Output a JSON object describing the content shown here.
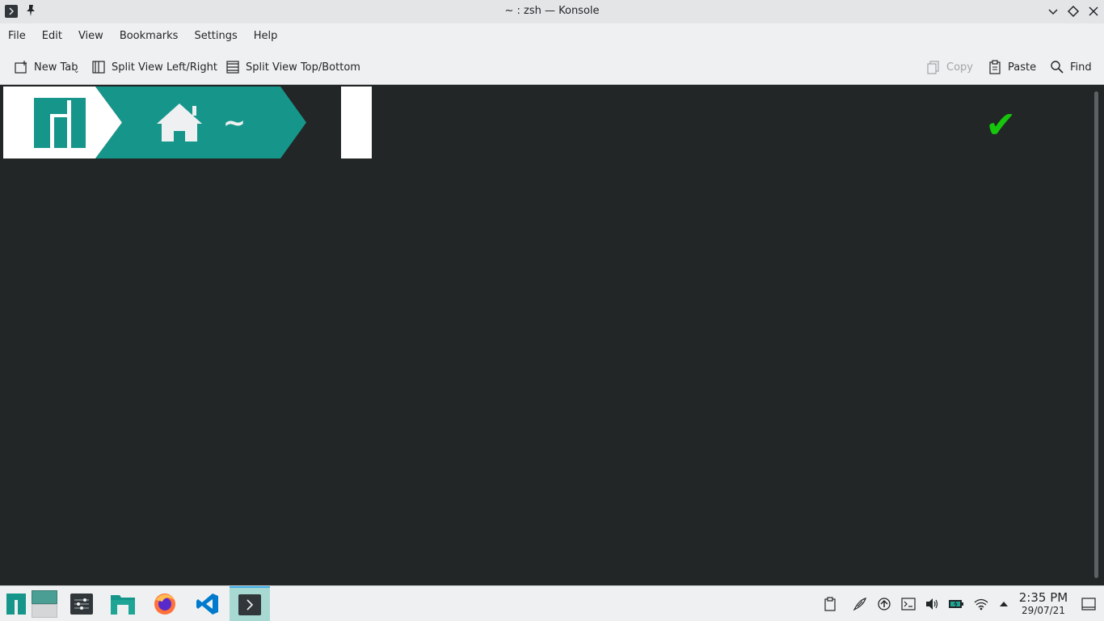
{
  "window": {
    "title": "~ : zsh — Konsole"
  },
  "menu": [
    "File",
    "Edit",
    "View",
    "Bookmarks",
    "Settings",
    "Help"
  ],
  "toolbar": {
    "new_tab": "New Tab",
    "split_lr": "Split View Left/Right",
    "split_tb": "Split View Top/Bottom",
    "copy": "Copy",
    "paste": "Paste",
    "find": "Find"
  },
  "terminal": {
    "prompt_dir": "~",
    "status_symbol": "✔"
  },
  "taskbar": {
    "tasks": [
      "manjaro-menu-icon",
      "desktop-pager",
      "settings-app-icon",
      "file-manager-icon",
      "firefox-icon",
      "vscode-icon",
      "konsole-icon"
    ],
    "clock": {
      "time": "2:35 PM",
      "date": "29/07/21"
    }
  },
  "colors": {
    "accent_teal": "#16968a",
    "terminal_bg": "#232627",
    "check_green": "#16c60c",
    "active_task": "#a8d8d2"
  }
}
